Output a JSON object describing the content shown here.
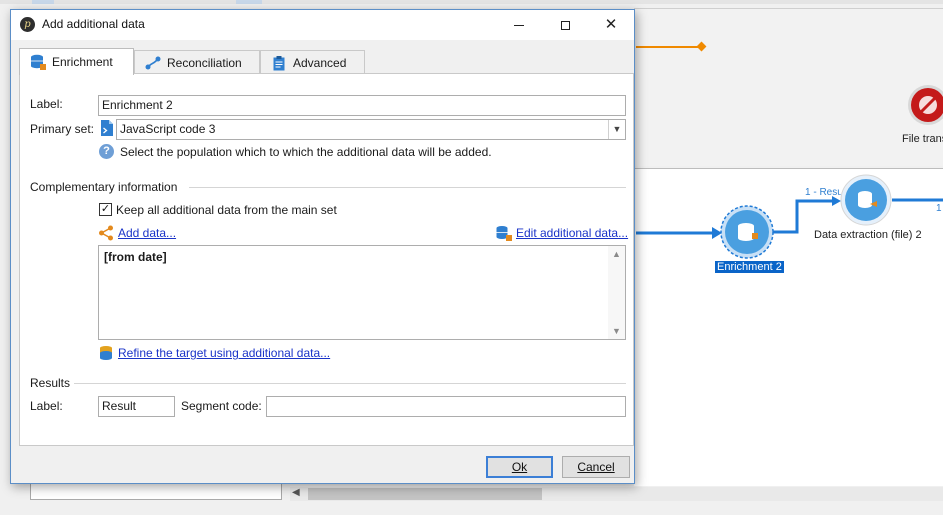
{
  "dialog": {
    "title": "Add additional data",
    "tabs": [
      {
        "label": "Enrichment",
        "icon": "enrichment-icon"
      },
      {
        "label": "Reconciliation",
        "icon": "reconciliation-icon"
      },
      {
        "label": "Advanced",
        "icon": "clipboard-icon"
      }
    ],
    "label_caption": "Label:",
    "label_value": "Enrichment 2",
    "primary_set_caption": "Primary set:",
    "primary_set_value": "JavaScript code 3",
    "primary_set_help": "Select the population which to which the additional data will be added.",
    "complementary_heading": "Complementary information",
    "keep_all_label": "Keep all additional data from the main set",
    "keep_all_checked": true,
    "add_data_link": "Add data...",
    "edit_additional_link": "Edit additional data...",
    "additional_data_content": "[from date]",
    "refine_link": "Refine the target using additional data...",
    "results_heading": "Results",
    "result_label_caption": "Label:",
    "result_label_value": "Result",
    "segment_code_caption": "Segment code:",
    "segment_code_value": "",
    "ok_button": "Ok",
    "cancel_button": "Cancel"
  },
  "canvas": {
    "nodes": [
      {
        "label": "Enrichment 2",
        "selected": true
      },
      {
        "label": "Data extraction (file) 2",
        "selected": false
      },
      {
        "label": "File trans",
        "selected": false
      }
    ],
    "connections": [
      {
        "label": "1 - Resu"
      },
      {
        "label": "1"
      }
    ],
    "colors": {
      "link": "#1f7ad6",
      "orange": "#f08a00",
      "node": "#4a9fe0"
    }
  }
}
